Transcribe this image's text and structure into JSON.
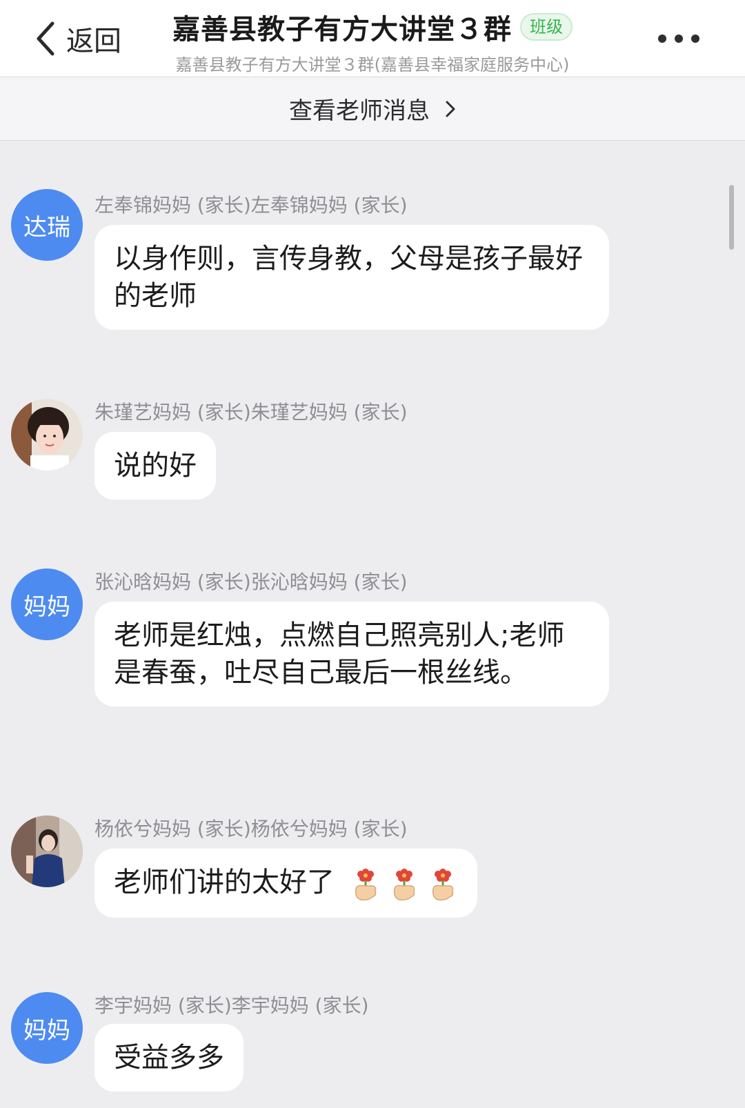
{
  "header": {
    "back_label": "返回",
    "title": "嘉善县教子有方大讲堂３群",
    "badge": "班级",
    "subtitle": "嘉善县教子有方大讲堂３群(嘉善县幸福家庭服务中心)"
  },
  "teacher_bar": {
    "label": "查看老师消息"
  },
  "messages": [
    {
      "avatar_text": "达瑞",
      "sender": "左奉锦妈妈 (家长)左奉锦妈妈 (家长)",
      "text": "以身作则，言传身教，父母是孩子最好的老师"
    },
    {
      "avatar_text": "",
      "avatar_icon": "user-photo",
      "sender": "朱瑾艺妈妈 (家长)朱瑾艺妈妈 (家长)",
      "text": "说的好"
    },
    {
      "avatar_text": "妈妈",
      "sender": "张沁晗妈妈 (家长)张沁晗妈妈 (家长)",
      "text": "老师是红烛，点燃自己照亮别人;老师是春蚕，吐尽自己最后一根丝线。"
    },
    {
      "avatar_text": "",
      "avatar_icon": "user-photo",
      "sender": "杨依兮妈妈 (家长)杨依兮妈妈 (家长)",
      "text": "老师们讲的太好了",
      "emojis": [
        "flower-hand-icon",
        "flower-hand-icon",
        "flower-hand-icon"
      ]
    },
    {
      "avatar_text": "妈妈",
      "sender": "李宇妈妈 (家长)李宇妈妈 (家长)",
      "text": "受益多多"
    }
  ],
  "colors": {
    "avatar_blue": "#4d8bf0",
    "badge_green": "#35b44a",
    "background": "#ededf0"
  }
}
